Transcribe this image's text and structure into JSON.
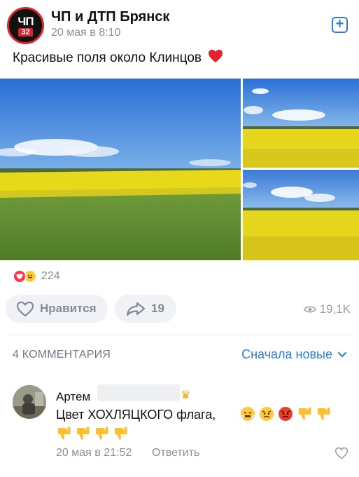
{
  "header": {
    "logo_line1": "ЧП",
    "logo_line2": "32",
    "group_name": "ЧП и ДТП Брянск",
    "post_time": "20 мая в 8:10",
    "subscribe_symbol": "+"
  },
  "post": {
    "text": "Красивые поля около Клинцов"
  },
  "reactions": {
    "count": "224"
  },
  "actions": {
    "like_label": "Нравится",
    "share_count": "19",
    "views": "19,1K"
  },
  "comments": {
    "count_label": "4 КОММЕНТАРИЯ",
    "sort_label": "Сначала новые",
    "items": [
      {
        "author": "Артем",
        "text": "Цвет ХОХЛЯЦКОГО флага,",
        "time": "20 мая в 21:52",
        "reply_label": "Ответить"
      }
    ]
  },
  "colors": {
    "accent": "#2a7fd4",
    "secondary_text": "#8b8e94",
    "button_bg": "#f0f2f5",
    "reaction_heart": "#ff3347"
  }
}
